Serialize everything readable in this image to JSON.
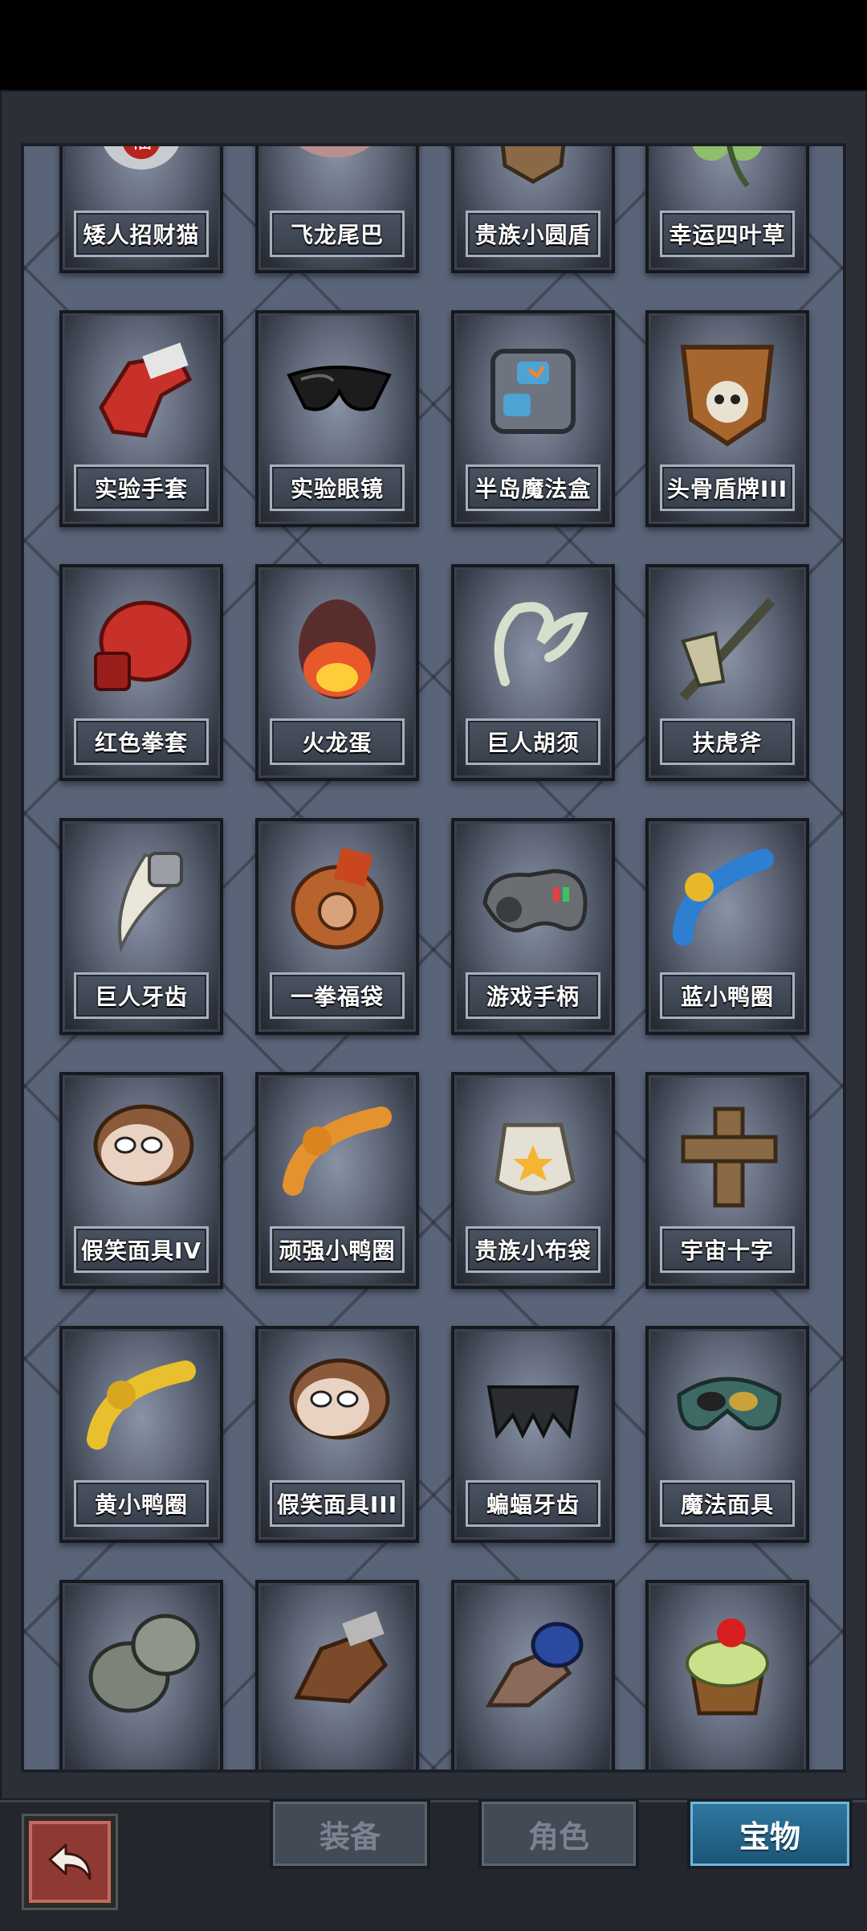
{
  "grid": {
    "rows": [
      [
        "矮人招财猫",
        "飞龙尾巴",
        "贵族小圆盾",
        "幸运四叶草"
      ],
      [
        "实验手套",
        "实验眼镜",
        "半岛魔法盒",
        "头骨盾牌III"
      ],
      [
        "红色拳套",
        "火龙蛋",
        "巨人胡须",
        "扶虎斧"
      ],
      [
        "巨人牙齿",
        "一拳福袋",
        "游戏手柄",
        "蓝小鸭圈"
      ],
      [
        "假笑面具IV",
        "顽强小鸭圈",
        "贵族小布袋",
        "宇宙十字"
      ],
      [
        "黄小鸭圈",
        "假笑面具III",
        "蝙蝠牙齿",
        "魔法面具"
      ],
      [
        "",
        "",
        "",
        ""
      ]
    ]
  },
  "icons": [
    [
      "lucky-cat-icon",
      "dragon-tail-icon",
      "small-shield-icon",
      "four-leaf-clover-icon"
    ],
    [
      "lab-glove-icon",
      "lab-glasses-icon",
      "magic-box-icon",
      "skull-shield-icon"
    ],
    [
      "boxing-glove-icon",
      "dragon-egg-icon",
      "giant-beard-icon",
      "axe-icon"
    ],
    [
      "giant-tooth-icon",
      "fist-bag-icon",
      "gamepad-icon",
      "blue-duck-ring-icon"
    ],
    [
      "grin-mask-icon",
      "orange-duck-ring-icon",
      "noble-pouch-icon",
      "cosmic-cross-icon"
    ],
    [
      "yellow-duck-ring-icon",
      "grin-mask-icon",
      "bat-teeth-icon",
      "magic-mask-icon"
    ],
    [
      "armor-gauntlet-icon",
      "fur-glove-icon",
      "spiked-gauntlet-icon",
      "cupcake-icon"
    ]
  ],
  "tabs": [
    {
      "label": "装备",
      "active": false
    },
    {
      "label": "角色",
      "active": false
    },
    {
      "label": "宝物",
      "active": true
    }
  ],
  "colors": {
    "panel": "#5a6479",
    "active_tab": "#2f78a1",
    "back_button": "#8e3a33"
  }
}
